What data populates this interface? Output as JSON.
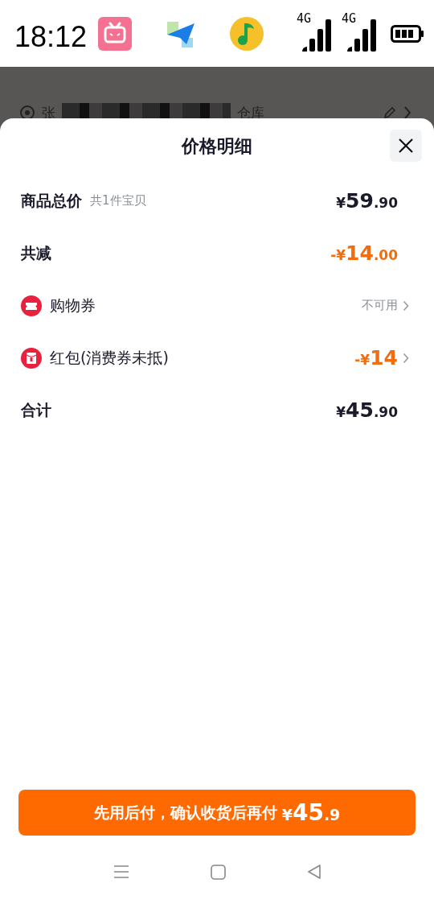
{
  "status_bar": {
    "time": "18:12",
    "signals": [
      {
        "label": "4G"
      },
      {
        "label": "4G"
      }
    ]
  },
  "backdrop": {
    "address_start": "张",
    "address_end": "仓库"
  },
  "sheet": {
    "title": "价格明细",
    "rows": [
      {
        "kind": "summary",
        "label": "商品总价",
        "note": "共1件宝贝",
        "price": {
          "prefix": "¥",
          "main": "59",
          "decimal": ".90"
        },
        "color": "#1a1a2a"
      },
      {
        "kind": "summary",
        "label": "共减",
        "price": {
          "prefix": "-¥",
          "main": "14",
          "decimal": ".00"
        },
        "color": "#f06d10"
      },
      {
        "kind": "coupon",
        "label": "购物券",
        "status": "不可用",
        "color": "#8a8d96"
      },
      {
        "kind": "envelope",
        "label": "红包(消费券未抵)",
        "price": {
          "prefix": "-¥",
          "main": "14"
        },
        "color": "#f06d10"
      },
      {
        "kind": "summary",
        "label": "合计",
        "price": {
          "prefix": "¥",
          "main": "45",
          "decimal": ".90"
        },
        "color": "#1a1a2a"
      }
    ],
    "pay_button": {
      "label": "先用后付，确认收货后再付",
      "price": {
        "prefix": "¥",
        "main": "45",
        "decimal": ".9"
      }
    }
  }
}
